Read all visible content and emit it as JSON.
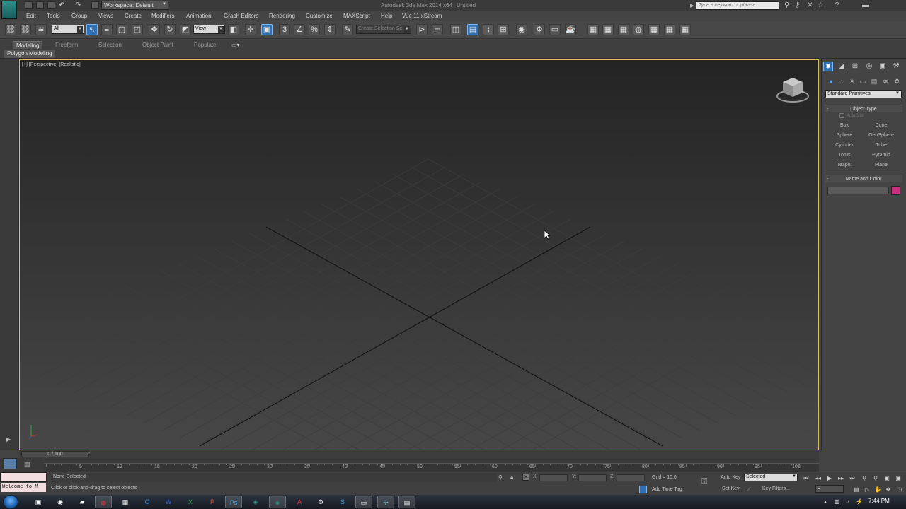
{
  "titlebar": {
    "workspace": "Workspace: Default",
    "app_title": "Autodesk 3ds Max 2014 x64",
    "doc_title": "Untitled",
    "search_placeholder": "Type a keyword or phrase"
  },
  "menubar": [
    "Edit",
    "Tools",
    "Group",
    "Views",
    "Create",
    "Modifiers",
    "Animation",
    "Graph Editors",
    "Rendering",
    "Customize",
    "MAXScript",
    "Help",
    "Vue 11 xStream"
  ],
  "toolbar": {
    "selection_filter": "All",
    "reference_coord": "View",
    "named_selection": "Create Selection Se"
  },
  "ribbon": {
    "tabs": [
      "Modeling",
      "Freeform",
      "Selection",
      "Object Paint",
      "Populate"
    ],
    "active_tab": "Modeling",
    "sub_panel": "Polygon Modeling"
  },
  "viewport": {
    "label": "[+] [Perspective] [Realistic]"
  },
  "command_panel": {
    "category": "Standard Primitives",
    "object_type_title": "Object Type",
    "autogrid": "AutoGrid",
    "primitives": [
      "Box",
      "Cone",
      "Sphere",
      "GeoSphere",
      "Cylinder",
      "Tube",
      "Torus",
      "Pyramid",
      "Teapot",
      "Plane"
    ],
    "name_color_title": "Name and Color",
    "object_color": "#c8307e"
  },
  "timeline": {
    "frame_display": "0 / 100",
    "ticks": [
      "5",
      "10",
      "15",
      "20",
      "25",
      "30",
      "35",
      "40",
      "45",
      "50",
      "55",
      "60",
      "65",
      "70",
      "75",
      "80",
      "85",
      "90",
      "95",
      "100"
    ]
  },
  "status": {
    "maxscript": "Welcome to M",
    "selection": "None Selected",
    "hint": "Click or click-and-drag to select objects",
    "x_label": "X:",
    "y_label": "Y:",
    "z_label": "Z:",
    "grid": "Grid = 10.0",
    "add_time_tag": "Add Time Tag",
    "auto_key": "Auto Key",
    "set_key": "Set Key",
    "key_mode": "Selected",
    "key_filters": "Key Filters...",
    "current_frame": "0"
  },
  "taskbar": {
    "clock": "7:44 PM"
  }
}
